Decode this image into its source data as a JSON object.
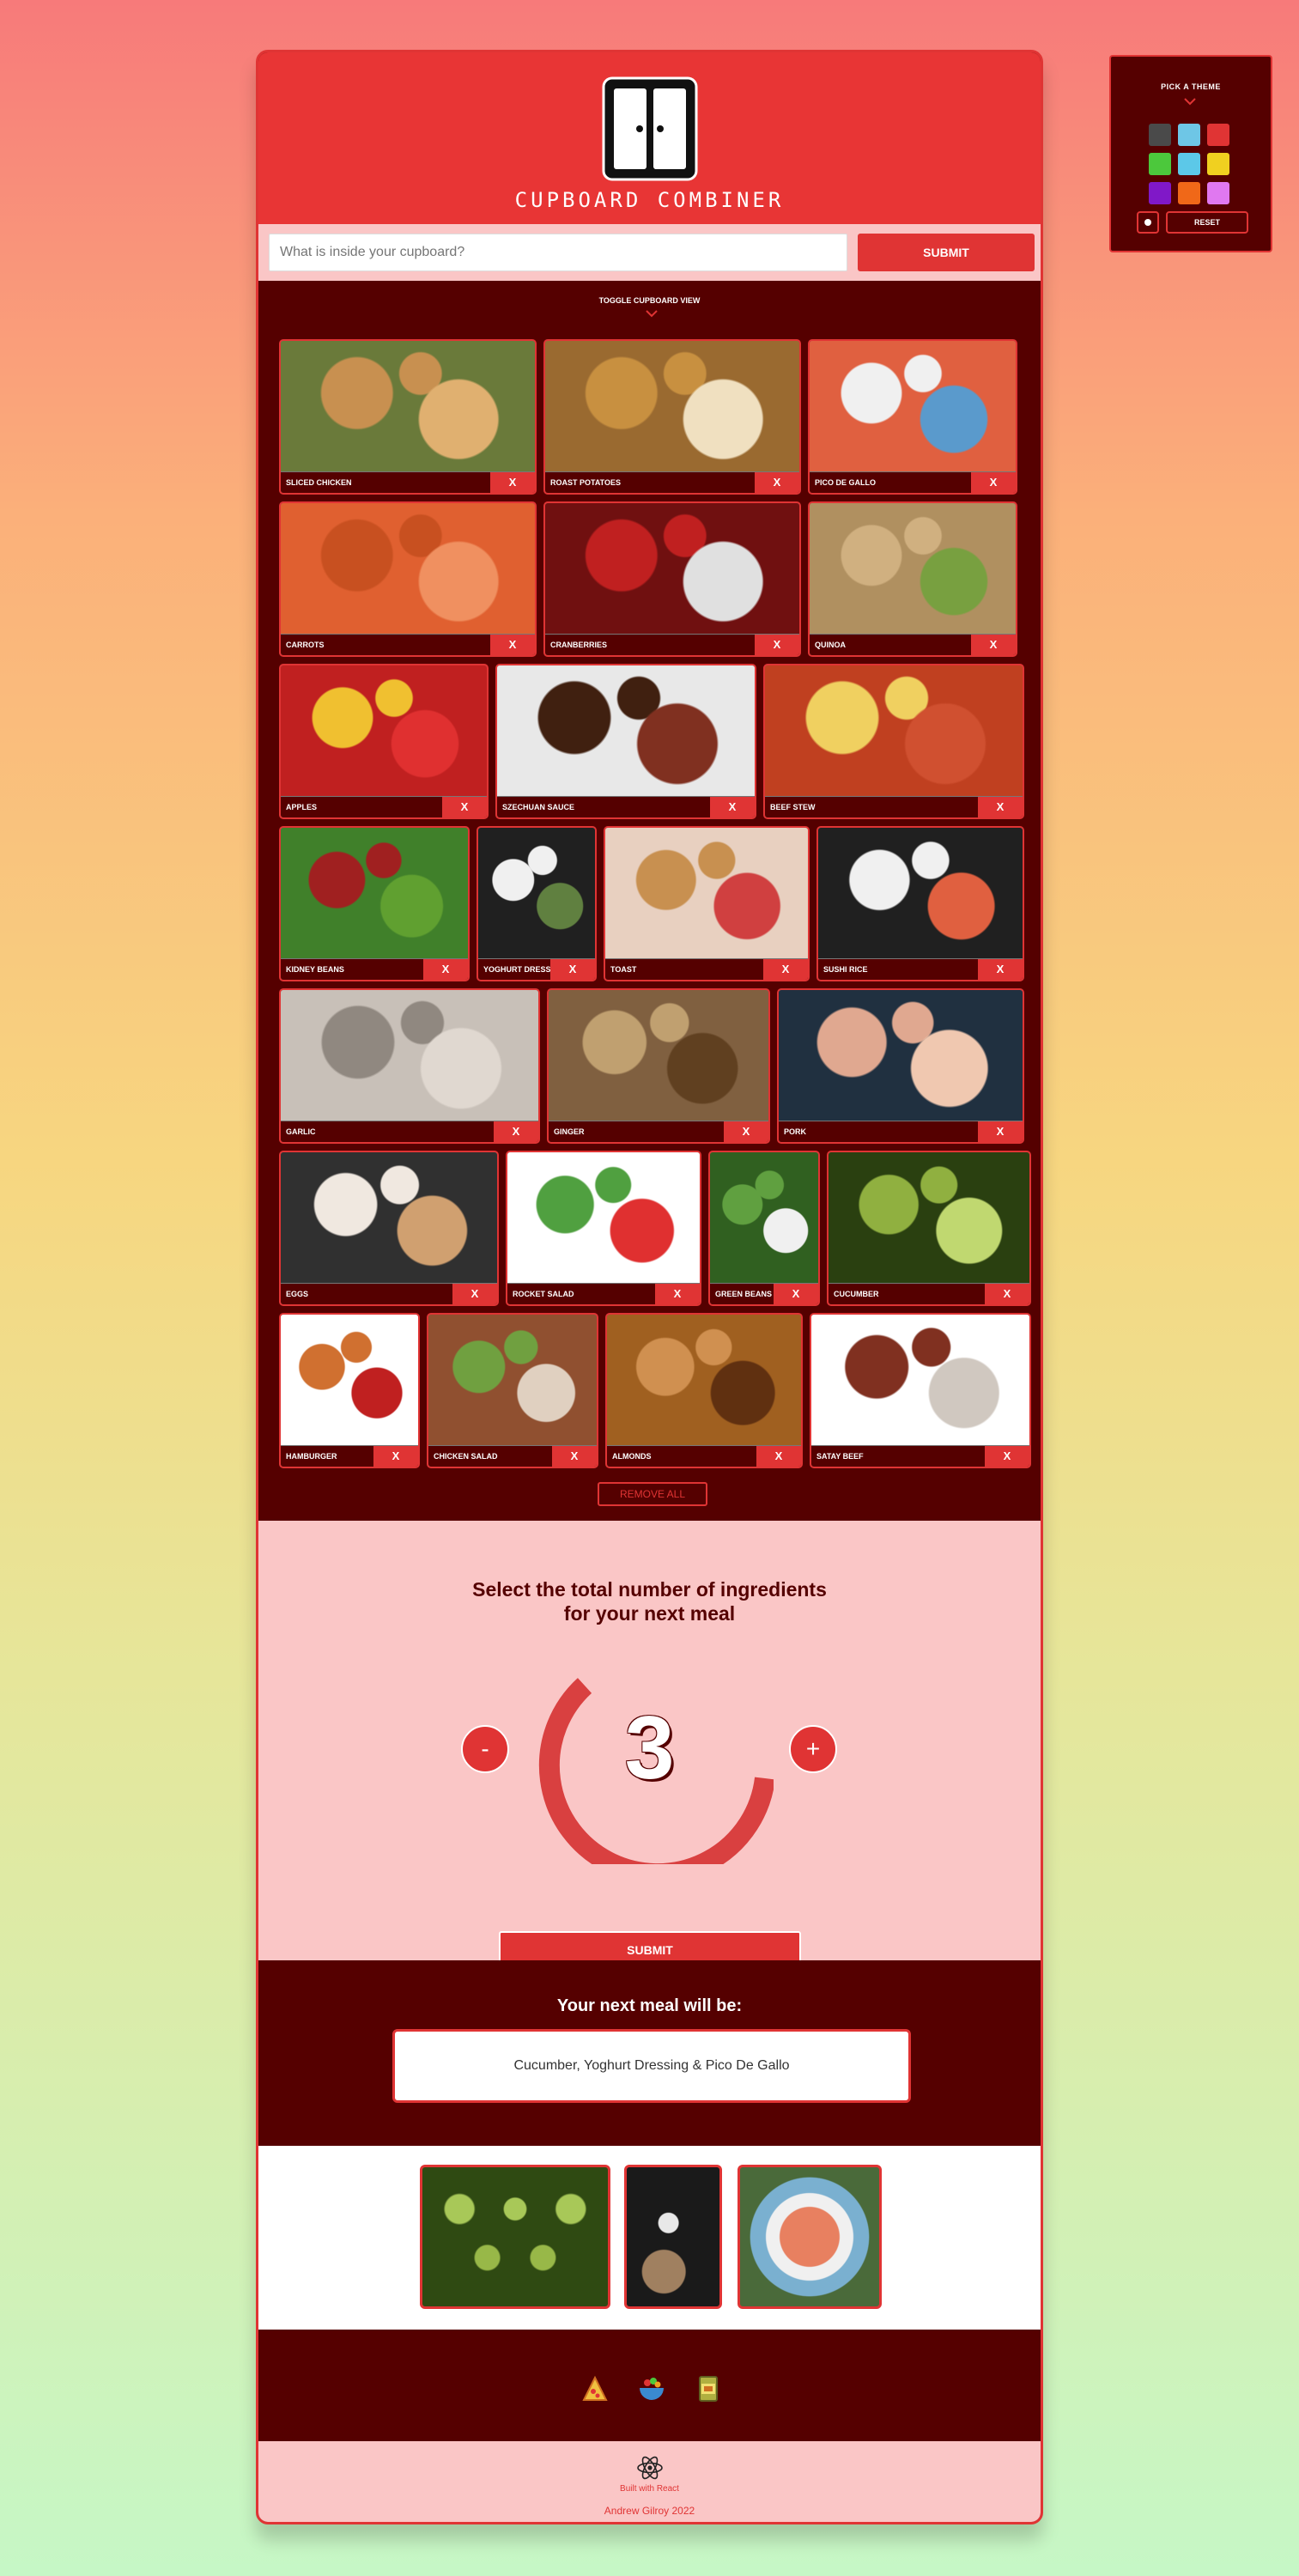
{
  "theme_panel": {
    "title": "PICK A THEME",
    "swatches": [
      "#4a4a4a",
      "#6ec6e6",
      "#e03434",
      "#4cc83c",
      "#5cc8e8",
      "#f0d020",
      "#8018c8",
      "#f06818",
      "#e078f0"
    ],
    "reset_label": "RESET"
  },
  "brand": {
    "name": "CUPBOARD COMBINER"
  },
  "search": {
    "placeholder": "What is inside your cupboard?",
    "submit_label": "SUBMIT"
  },
  "cupboard": {
    "toggle_label": "TOGGLE CUPBOARD VIEW",
    "remove_label": "X",
    "items": [
      "SLICED CHICKEN",
      "ROAST POTATOES",
      "PICO DE GALLO",
      "CARROTS",
      "CRANBERRIES",
      "QUINOA",
      "APPLES",
      "SZECHUAN SAUCE",
      "BEEF STEW",
      "KIDNEY BEANS",
      "YOGHURT DRESSING",
      "TOAST",
      "SUSHI RICE",
      "GARLIC",
      "GINGER",
      "PORK",
      "EGGS",
      "ROCKET SALAD",
      "GREEN BEANS",
      "CUCUMBER",
      "HAMBURGER",
      "CHICKEN SALAD",
      "ALMONDS",
      "SATAY BEEF"
    ],
    "remove_all_label": "REMOVE ALL"
  },
  "counter": {
    "title_line1": "Select the total number of ingredients",
    "title_line2": "for your next meal",
    "minus": "-",
    "plus": "+",
    "value": "3",
    "submit_label": "SUBMIT"
  },
  "result": {
    "title": "Your next meal will be:",
    "meal": "Cucumber, Yoghurt Dressing & Pico De Gallo"
  },
  "footer": {
    "icons": [
      "pizza-icon",
      "bowl-icon",
      "tin-can-icon"
    ],
    "built_with": "Built with React",
    "credit": "Andrew Gilroy 2022"
  }
}
